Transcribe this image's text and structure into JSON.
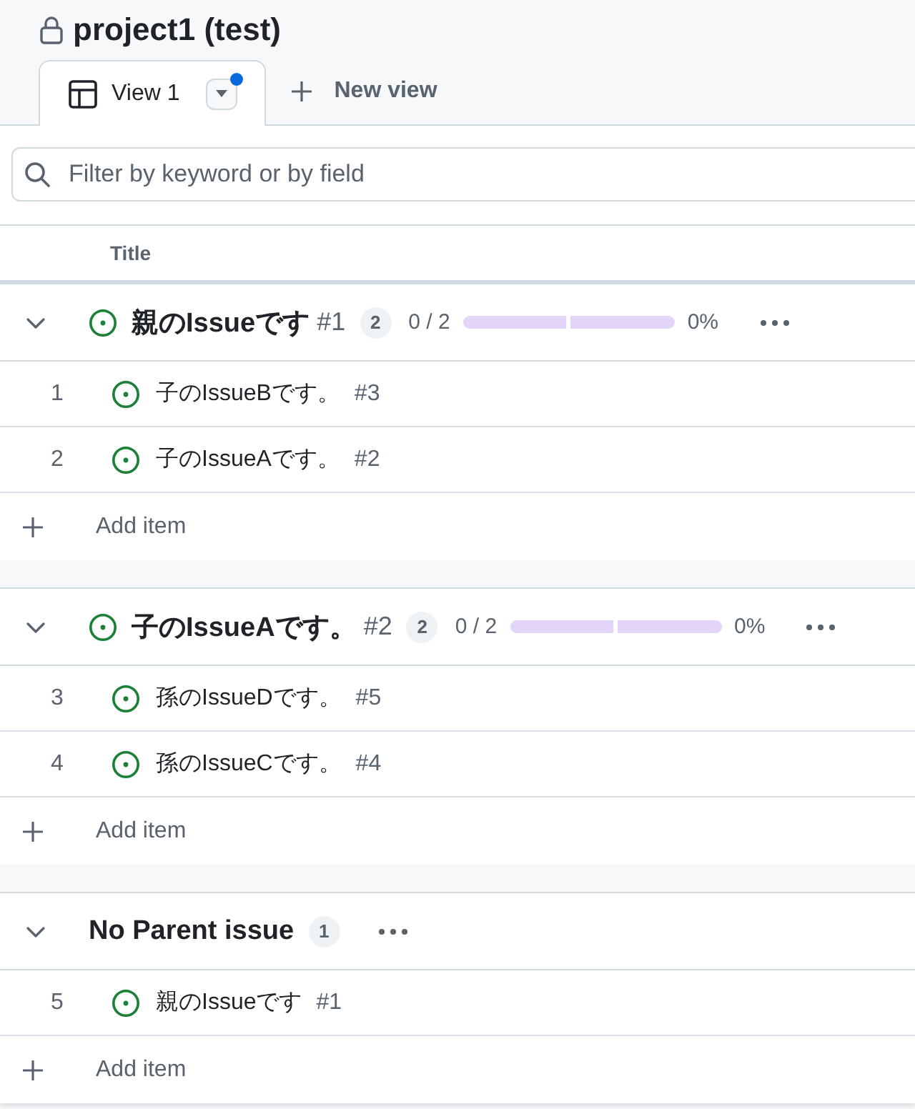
{
  "header": {
    "title": "project1 (test)",
    "locked": true
  },
  "tabs": [
    {
      "label": "View 1",
      "selected": true,
      "unsaved": true
    }
  ],
  "new_view": "New view",
  "filter": {
    "placeholder": "Filter by keyword or by field"
  },
  "columns": [
    "Title"
  ],
  "groups": [
    {
      "kind": "issue",
      "expanded": true,
      "title": "親のIssueです",
      "number": "#1",
      "count": "2",
      "progress": {
        "text": "0 / 2",
        "segments": [
          {
            "filled": false
          },
          {
            "filled": false
          }
        ],
        "percent": "0%"
      },
      "items": [
        {
          "index": "1",
          "title": "子のIssueBです。",
          "number": "#3"
        },
        {
          "index": "2",
          "title": "子のIssueAです。",
          "number": "#2"
        }
      ],
      "add_item": "Add item"
    },
    {
      "kind": "issue",
      "expanded": true,
      "title": "子のIssueAです。",
      "number": "#2",
      "count": "2",
      "progress": {
        "text": "0 / 2",
        "segments": [
          {
            "filled": false
          },
          {
            "filled": false
          }
        ],
        "percent": "0%"
      },
      "items": [
        {
          "index": "3",
          "title": "孫のIssueDです。",
          "number": "#5"
        },
        {
          "index": "4",
          "title": "孫のIssueCです。",
          "number": "#4"
        }
      ],
      "add_item": "Add item"
    },
    {
      "kind": "none",
      "expanded": true,
      "title": "No Parent issue",
      "count": "1",
      "items": [
        {
          "index": "5",
          "title": "親のIssueです",
          "number": "#1"
        }
      ],
      "add_item": "Add item"
    }
  ]
}
